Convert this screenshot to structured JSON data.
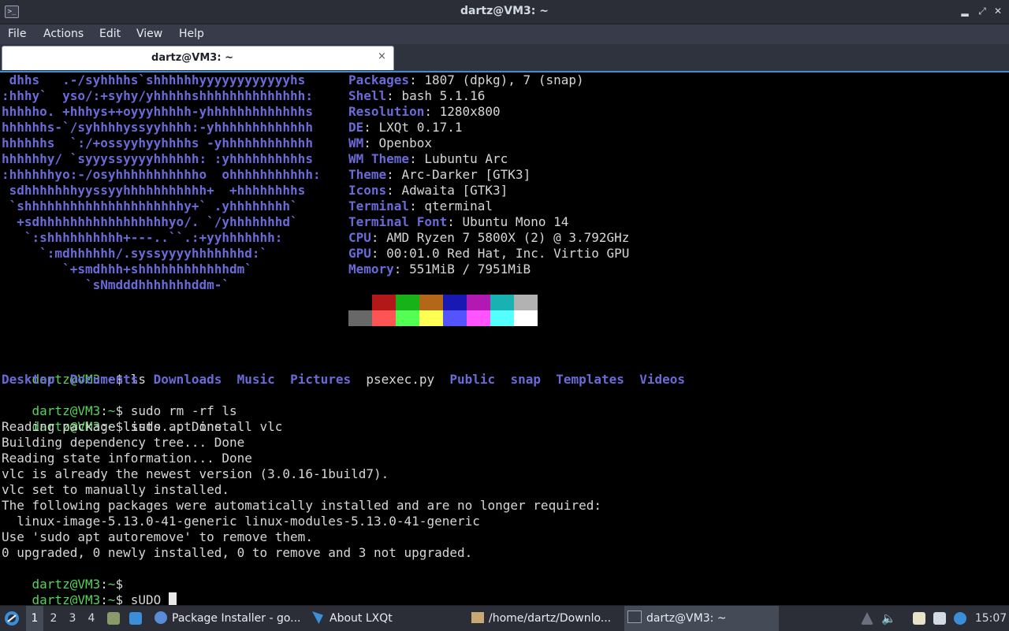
{
  "window": {
    "title": "dartz@VM3: ~",
    "app_icon_glyph": ">_"
  },
  "menu": [
    "File",
    "Actions",
    "Edit",
    "View",
    "Help"
  ],
  "tab": {
    "label": "dartz@VM3: ~",
    "close": "×"
  },
  "neofetch": {
    "art": [
      " dhhs   .-/syhhhhs`shhhhhhyyyyyyyyyyyyhs",
      ":hhhy`  yso/:+syhy/yhhhhhshhhhhhhhhhhhhh:",
      "hhhhho. +hhhys++oyyyhhhhh-yhhhhhhhhhhhhhs",
      "hhhhhhs-`/syhhhhyssyyhhhh:-yhhhhhhhhhhhhh",
      "hhhhhhs  `:/+ossyyhyyhhhhs -yhhhhhhhhhhhh",
      "hhhhhhy/ `syyyssyyyyhhhhhh: :yhhhhhhhhhhs",
      ":hhhhhhyo:-/osyhhhhhhhhhhho  ohhhhhhhhhhh:",
      " sdhhhhhhhyyssyyhhhhhhhhhhh+  +hhhhhhhhs",
      " `shhhhhhhhhhhhhhhhhhhhhy+` .yhhhhhhhh`",
      "  +sdhhhhhhhhhhhhhhhhhyo/. `/yhhhhhhhd`",
      "   `:shhhhhhhhhh+---..``.:+yyhhhhhhh:",
      "     `:mdhhhhhh/.syssyyyyhhhhhhhd:`",
      "        `+smdhhh+shhhhhhhhhhhhdm`",
      "           `sNmdddhhhhhhhddm-`"
    ],
    "info": [
      {
        "key": "Packages",
        "value": "1807 (dpkg), 7 (snap)"
      },
      {
        "key": "Shell",
        "value": "bash 5.1.16"
      },
      {
        "key": "Resolution",
        "value": "1280x800"
      },
      {
        "key": "DE",
        "value": "LXQt 0.17.1"
      },
      {
        "key": "WM",
        "value": "Openbox"
      },
      {
        "key": "WM Theme",
        "value": "Lubuntu Arc"
      },
      {
        "key": "Theme",
        "value": "Arc-Darker [GTK3]"
      },
      {
        "key": "Icons",
        "value": "Adwaita [GTK3]"
      },
      {
        "key": "Terminal",
        "value": "qterminal"
      },
      {
        "key": "Terminal Font",
        "value": "Ubuntu Mono 14"
      },
      {
        "key": "CPU",
        "value": "AMD Ryzen 7 5800X (2) @ 3.792GHz"
      },
      {
        "key": "GPU",
        "value": "00:01.0 Red Hat, Inc. Virtio GPU"
      },
      {
        "key": "Memory",
        "value": "551MiB / 7951MiB"
      }
    ],
    "separator": ": ",
    "palette_top": [
      "#000000",
      "#b21818",
      "#18b218",
      "#b26818",
      "#1818b2",
      "#b218b2",
      "#18b2b2",
      "#b2b2b2"
    ],
    "palette_bottom": [
      "#686868",
      "#ff5454",
      "#54ff54",
      "#ffff54",
      "#5454ff",
      "#ff54ff",
      "#54ffff",
      "#ffffff"
    ]
  },
  "prompt": {
    "user_host": "dartz@VM3",
    "colon": ":",
    "path": "~",
    "symbol": "$ "
  },
  "session": {
    "cmd_ls": "ls",
    "ls_output": [
      {
        "name": "Desktop",
        "type": "dir"
      },
      {
        "name": "Documents",
        "type": "dir"
      },
      {
        "name": "Downloads",
        "type": "dir"
      },
      {
        "name": "Music",
        "type": "dir"
      },
      {
        "name": "Pictures",
        "type": "dir"
      },
      {
        "name": "psexec.py",
        "type": "file"
      },
      {
        "name": "Public",
        "type": "dir"
      },
      {
        "name": "snap",
        "type": "dir"
      },
      {
        "name": "Templates",
        "type": "dir"
      },
      {
        "name": "Videos",
        "type": "dir"
      }
    ],
    "cmd_rm": "sudo rm -rf ls",
    "cmd_apt": "sudo apt install vlc",
    "apt_output": [
      "Reading package lists... Done",
      "Building dependency tree... Done",
      "Reading state information... Done",
      "vlc is already the newest version (3.0.16-1build7).",
      "vlc set to manually installed.",
      "The following packages were automatically installed and are no longer required:",
      "  linux-image-5.13.0-41-generic linux-modules-5.13.0-41-generic",
      "Use 'sudo apt autoremove' to remove them.",
      "0 upgraded, 0 newly installed, 0 to remove and 3 not upgraded."
    ],
    "cmd_empty": "",
    "cmd_current": "sUDO "
  },
  "taskbar": {
    "workspaces": [
      "1",
      "2",
      "3",
      "4"
    ],
    "active_workspace": "1",
    "tasks": [
      {
        "label": "Package Installer - go...",
        "icon": "package-installer-icon",
        "active": false
      },
      {
        "label": "About LXQt",
        "icon": "lxqt-icon",
        "active": false
      },
      {
        "label": "/home/dartz/Downlo...",
        "icon": "folder-icon",
        "active": false
      },
      {
        "label": "dartz@VM3: ~",
        "icon": "terminal-icon",
        "active": true
      }
    ],
    "clock": "15:07"
  },
  "colors": {
    "accent": "#3b8ed8",
    "prompt_green": "#55d35b",
    "logo_blue": "#6a6ad8"
  }
}
